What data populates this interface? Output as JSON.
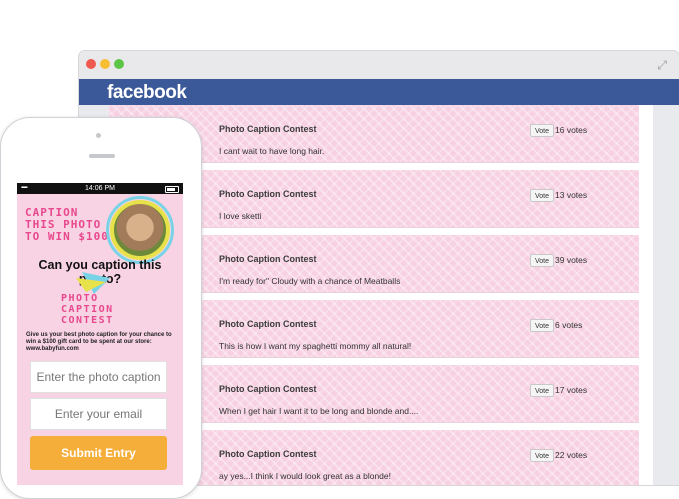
{
  "browser": {
    "logo": "facebook"
  },
  "feed": [
    {
      "title": "Photo Caption Contest",
      "caption": "I cant wait to have long hair.",
      "vote_label": "Vote",
      "votes": "16 votes"
    },
    {
      "title": "Photo Caption Contest",
      "caption": "I love sketti",
      "vote_label": "Vote",
      "votes": "13 votes"
    },
    {
      "title": "Photo Caption Contest",
      "caption": "I'm ready for\" Cloudy with a chance of Meatballs",
      "vote_label": "Vote",
      "votes": "39 votes"
    },
    {
      "title": "Photo Caption Contest",
      "caption": "This is how I want my spaghetti mommy all natural!",
      "vote_label": "Vote",
      "votes": "6 votes"
    },
    {
      "title": "Photo Caption Contest",
      "caption": "When I get hair I want it to be long and blonde and....",
      "vote_label": "Vote",
      "votes": "17 votes"
    },
    {
      "title": "Photo Caption Contest",
      "caption": "ay yes...I think I would look great as a blonde!",
      "vote_label": "Vote",
      "votes": "22 votes"
    }
  ],
  "phone": {
    "status_time": "14:06 PM",
    "promo": {
      "line1": "CAPTION",
      "line2": "THIS PHOTO",
      "line3": "TO WIN $100"
    },
    "headline": "Can you caption this photo?",
    "contest_title": {
      "line1": "PHOTO",
      "line2": "CAPTION",
      "line3": "CONTEST"
    },
    "description": "Give us your best photo caption for your chance to win a $100 gift card to be spent at our store: www.babyfun.com",
    "caption_placeholder": "Enter the photo caption",
    "email_placeholder": "Enter your email",
    "submit_label": "Submit Entry"
  },
  "colors": {
    "facebook_blue": "#3b5998",
    "card_pink": "#f7d1e2",
    "accent_pink": "#e8488d",
    "submit_orange": "#f5ae3a"
  }
}
